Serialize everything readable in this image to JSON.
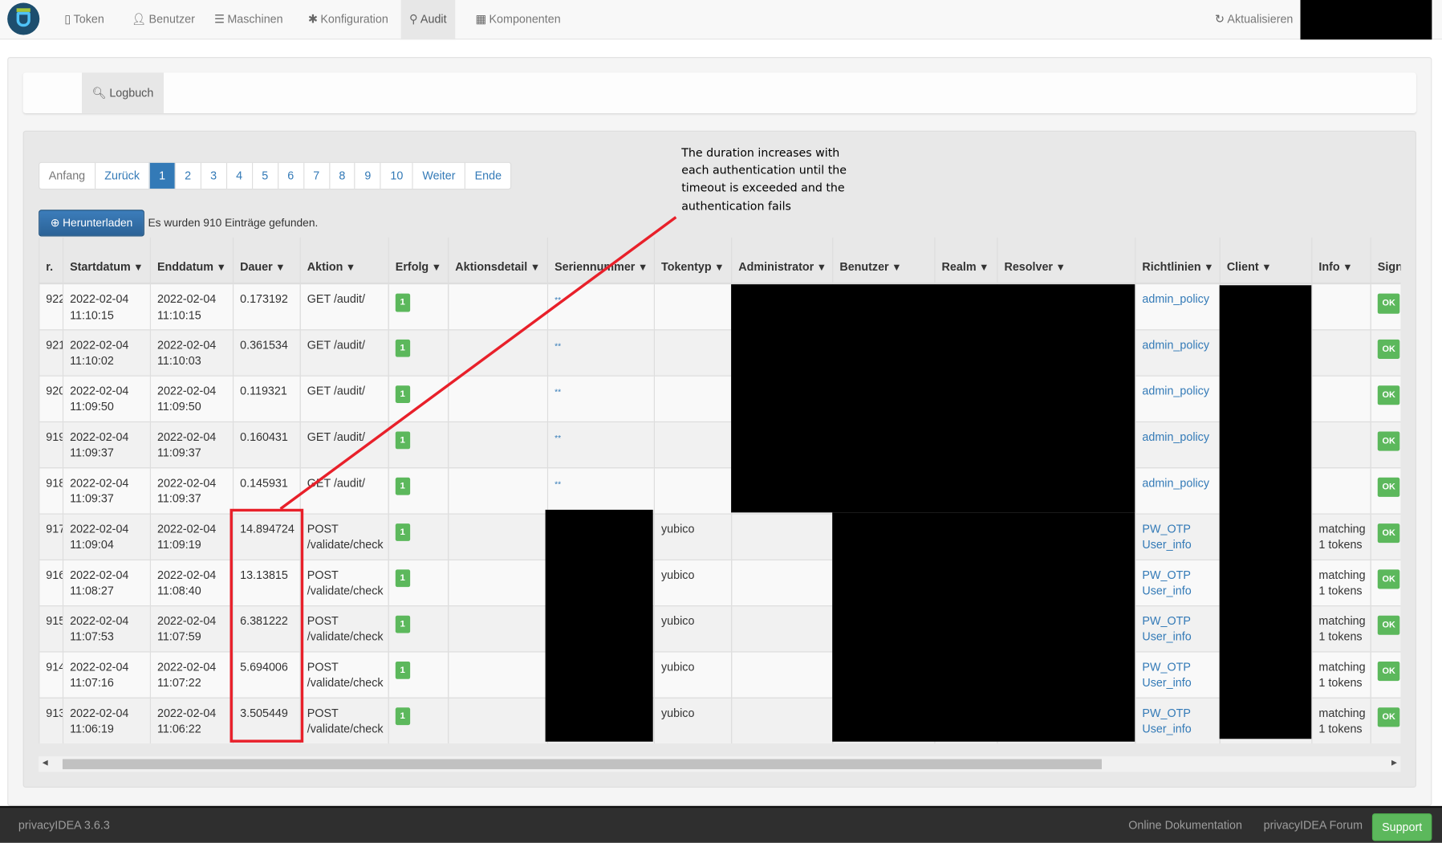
{
  "nav": {
    "items": [
      {
        "label": "Token",
        "icon": "mobile-icon"
      },
      {
        "label": "Benutzer",
        "icon": "user-icon"
      },
      {
        "label": "Maschinen",
        "icon": "server-icon"
      },
      {
        "label": "Konfiguration",
        "icon": "gear-icon"
      },
      {
        "label": "Audit",
        "icon": "search-icon",
        "active": true
      },
      {
        "label": "Komponenten",
        "icon": "calendar-icon"
      }
    ],
    "refresh": "Aktualisieren"
  },
  "tabs": {
    "logbuch": "Logbuch"
  },
  "pager": [
    "Anfang",
    "Zurück",
    "1",
    "2",
    "3",
    "4",
    "5",
    "6",
    "7",
    "8",
    "9",
    "10",
    "Weiter",
    "Ende"
  ],
  "pager_current": "1",
  "download": "Herunterladen",
  "found": "Es wurden 910 Einträge gefunden.",
  "annotation": "The duration increases with each authentication until the timeout is exceeded and the authentication fails",
  "annotation_color": "#e8202a",
  "columns": [
    "r.",
    "Startdatum",
    "Enddatum",
    "Dauer",
    "Aktion",
    "Erfolg",
    "Aktionsdetail",
    "Seriennummer",
    "Tokentyp",
    "Administrator",
    "Benutzer",
    "Realm",
    "Resolver",
    "Richtlinien",
    "Client",
    "Info",
    "Sign"
  ],
  "rows": [
    {
      "nr": "922",
      "start": [
        "2022-02-04",
        "11:10:15"
      ],
      "end": [
        "2022-02-04",
        "11:10:15"
      ],
      "dauer": "0.173192",
      "aktion": [
        "GET /audit/"
      ],
      "erfolg": "1",
      "serial": "**",
      "tokentyp": "",
      "richtlinien": [
        "admin_policy"
      ],
      "info": [],
      "sign": "OK"
    },
    {
      "nr": "921",
      "start": [
        "2022-02-04",
        "11:10:02"
      ],
      "end": [
        "2022-02-04",
        "11:10:03"
      ],
      "dauer": "0.361534",
      "aktion": [
        "GET /audit/"
      ],
      "erfolg": "1",
      "serial": "**",
      "tokentyp": "",
      "richtlinien": [
        "admin_policy"
      ],
      "info": [],
      "sign": "OK"
    },
    {
      "nr": "920",
      "start": [
        "2022-02-04",
        "11:09:50"
      ],
      "end": [
        "2022-02-04",
        "11:09:50"
      ],
      "dauer": "0.119321",
      "aktion": [
        "GET /audit/"
      ],
      "erfolg": "1",
      "serial": "**",
      "tokentyp": "",
      "richtlinien": [
        "admin_policy"
      ],
      "info": [],
      "sign": "OK"
    },
    {
      "nr": "919",
      "start": [
        "2022-02-04",
        "11:09:37"
      ],
      "end": [
        "2022-02-04",
        "11:09:37"
      ],
      "dauer": "0.160431",
      "aktion": [
        "GET /audit/"
      ],
      "erfolg": "1",
      "serial": "**",
      "tokentyp": "",
      "richtlinien": [
        "admin_policy"
      ],
      "info": [],
      "sign": "OK"
    },
    {
      "nr": "918",
      "start": [
        "2022-02-04",
        "11:09:37"
      ],
      "end": [
        "2022-02-04",
        "11:09:37"
      ],
      "dauer": "0.145931",
      "aktion": [
        "GET /audit/"
      ],
      "erfolg": "1",
      "serial": "**",
      "tokentyp": "",
      "richtlinien": [
        "admin_policy"
      ],
      "info": [],
      "sign": "OK"
    },
    {
      "nr": "917",
      "start": [
        "2022-02-04",
        "11:09:04"
      ],
      "end": [
        "2022-02-04",
        "11:09:19"
      ],
      "dauer": "14.894724",
      "aktion": [
        "POST",
        "/validate/check"
      ],
      "erfolg": "1",
      "serial": "",
      "tokentyp": "yubico",
      "richtlinien": [
        "PW_OTP",
        "User_info"
      ],
      "info": [
        "matching",
        "1 tokens"
      ],
      "sign": "OK"
    },
    {
      "nr": "916",
      "start": [
        "2022-02-04",
        "11:08:27"
      ],
      "end": [
        "2022-02-04",
        "11:08:40"
      ],
      "dauer": "13.13815",
      "aktion": [
        "POST",
        "/validate/check"
      ],
      "erfolg": "1",
      "serial": "",
      "tokentyp": "yubico",
      "richtlinien": [
        "PW_OTP",
        "User_info"
      ],
      "info": [
        "matching",
        "1 tokens"
      ],
      "sign": "OK"
    },
    {
      "nr": "915",
      "start": [
        "2022-02-04",
        "11:07:53"
      ],
      "end": [
        "2022-02-04",
        "11:07:59"
      ],
      "dauer": "6.381222",
      "aktion": [
        "POST",
        "/validate/check"
      ],
      "erfolg": "1",
      "serial": "",
      "tokentyp": "yubico",
      "richtlinien": [
        "PW_OTP",
        "User_info"
      ],
      "info": [
        "matching",
        "1 tokens"
      ],
      "sign": "OK"
    },
    {
      "nr": "914",
      "start": [
        "2022-02-04",
        "11:07:16"
      ],
      "end": [
        "2022-02-04",
        "11:07:22"
      ],
      "dauer": "5.694006",
      "aktion": [
        "POST",
        "/validate/check"
      ],
      "erfolg": "1",
      "serial": "",
      "tokentyp": "yubico",
      "richtlinien": [
        "PW_OTP",
        "User_info"
      ],
      "info": [
        "matching",
        "1 tokens"
      ],
      "sign": "OK"
    },
    {
      "nr": "913",
      "start": [
        "2022-02-04",
        "11:06:19"
      ],
      "end": [
        "2022-02-04",
        "11:06:22"
      ],
      "dauer": "3.505449",
      "aktion": [
        "POST",
        "/validate/check"
      ],
      "erfolg": "1",
      "serial": "",
      "tokentyp": "yubico",
      "richtlinien": [
        "PW_OTP",
        "User_info"
      ],
      "info": [
        "matching",
        "1 tokens"
      ],
      "sign": "OK"
    }
  ],
  "footer": {
    "version": "privacyIDEA 3.6.3",
    "docs": "Online Dokumentation",
    "forum": "privacyIDEA Forum",
    "support": "Support"
  }
}
